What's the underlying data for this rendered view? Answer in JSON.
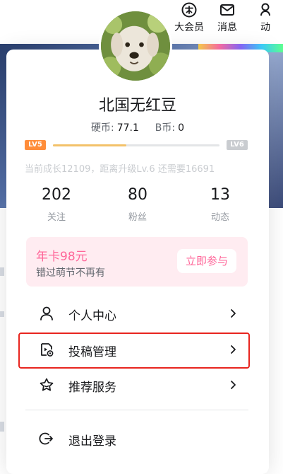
{
  "topnav": {
    "items": [
      {
        "icon": "vip-icon",
        "label": "大会员"
      },
      {
        "icon": "message-icon",
        "label": "消息"
      },
      {
        "icon": "dynamic-icon",
        "label": "动"
      }
    ]
  },
  "profile": {
    "username": "北国无红豆",
    "coins_label": "硬币:",
    "coins_value": "77.1",
    "bcoin_label": "B币:",
    "bcoin_value": "0",
    "level_current": "LV5",
    "level_next": "LV6",
    "level_progress": 0.44,
    "level_text": "当前成长12109，距离升级Lv.6 还需要16691"
  },
  "stats": [
    {
      "value": "202",
      "label": "关注"
    },
    {
      "value": "80",
      "label": "粉丝"
    },
    {
      "value": "13",
      "label": "动态"
    }
  ],
  "promo": {
    "title": "年卡98元",
    "subtitle": "错过萌节不再有",
    "button": "立即参与"
  },
  "menu": [
    {
      "icon": "user-icon",
      "label": "个人中心"
    },
    {
      "icon": "upload-manage-icon",
      "label": "投稿管理"
    },
    {
      "icon": "star-service-icon",
      "label": "推荐服务"
    },
    {
      "icon": "logout-icon",
      "label": "退出登录"
    }
  ],
  "colors": {
    "accent": "#ff6699",
    "highlight_border": "#e8251f",
    "level_badge": "#ff8d3a"
  }
}
